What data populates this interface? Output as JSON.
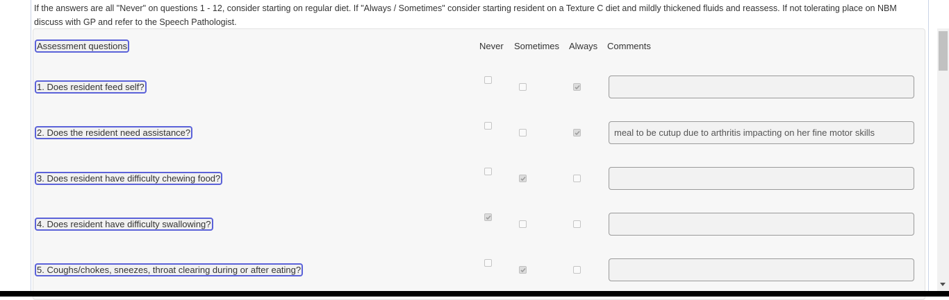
{
  "instructions": "If the answers are all \"Never\" on questions 1 - 12, consider starting on regular diet. If \"Always / Sometimes\" consider starting resident on a Texture C diet and mildly thickened fluids and reassess. If not tolerating place on NBM discuss with GP and refer to the Speech Pathologist.",
  "header": {
    "assessment_label": "Assessment questions",
    "never": "Never",
    "sometimes": "Sometimes",
    "always": "Always",
    "comments": "Comments"
  },
  "questions": [
    {
      "label": "1. Does resident feed self?",
      "answer": "always",
      "comment": ""
    },
    {
      "label": "2. Does the resident need assistance?",
      "answer": "always",
      "comment": "meal to be cutup due to arthritis impacting on her fine motor skills"
    },
    {
      "label": "3. Does resident have difficulty chewing food?",
      "answer": "sometimes",
      "comment": ""
    },
    {
      "label": "4. Does resident have difficulty swallowing?",
      "answer": "never",
      "comment": ""
    },
    {
      "label": "5. Coughs/chokes, sneezes, throat clearing during or after eating?",
      "answer": "sometimes",
      "comment": ""
    }
  ],
  "icons": {
    "checkmark": "check-icon",
    "scroll_down": "chevron-down-icon"
  },
  "colors": {
    "label_border": "#5b62d9",
    "checked_box": "#dcdcdc"
  }
}
